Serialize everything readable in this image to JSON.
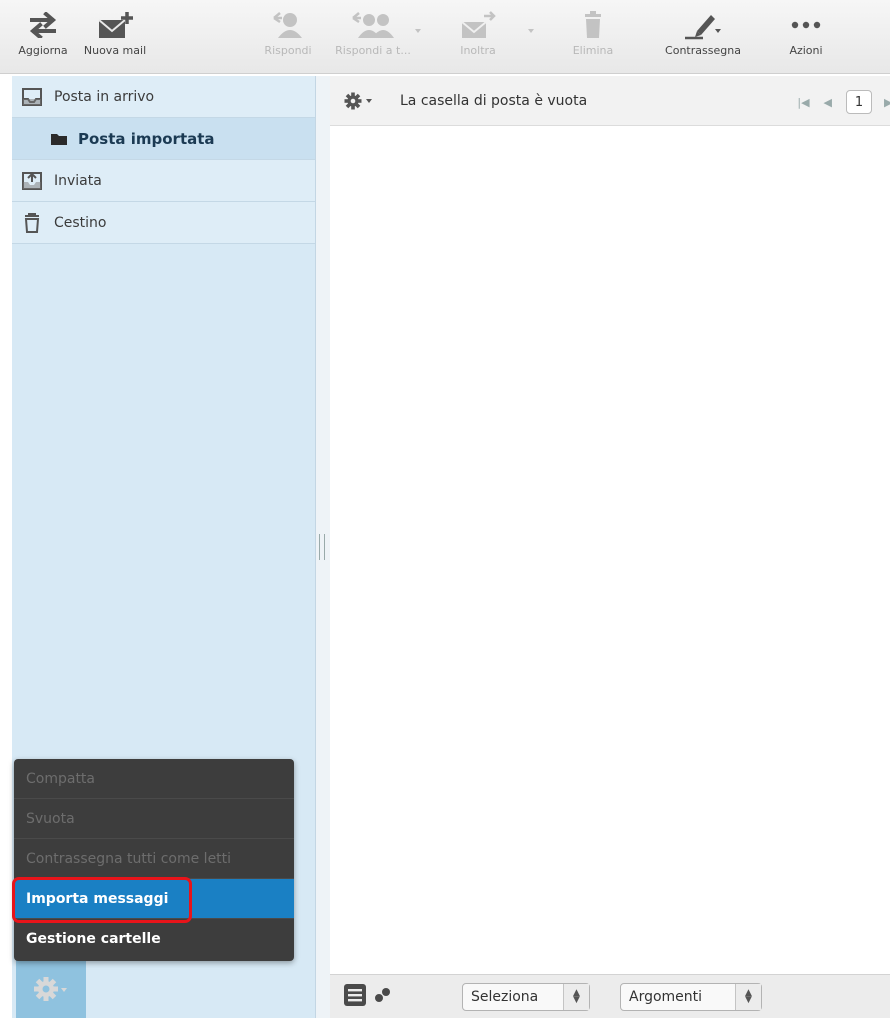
{
  "toolbar": {
    "refresh_label": "Aggiorna",
    "new_mail_label": "Nuova mail",
    "reply_label": "Rispondi",
    "reply_all_label": "Rispondi a t...",
    "forward_label": "Inoltra",
    "delete_label": "Elimina",
    "mark_label": "Contrassegna",
    "actions_label": "Azioni"
  },
  "sidebar": {
    "folders": [
      {
        "label": "Posta in arrivo",
        "icon": "inbox-icon"
      },
      {
        "label": "Posta importata",
        "icon": "folder-icon"
      },
      {
        "label": "Inviata",
        "icon": "sent-icon"
      },
      {
        "label": "Cestino",
        "icon": "trash-icon"
      }
    ]
  },
  "menu": {
    "items": [
      {
        "label": "Compatta",
        "enabled": false
      },
      {
        "label": "Svuota",
        "enabled": false
      },
      {
        "label": "Contrassegna tutti come letti",
        "enabled": false
      },
      {
        "label": "Importa messaggi",
        "enabled": true,
        "selected": true
      },
      {
        "label": "Gestione cartelle",
        "enabled": true
      }
    ]
  },
  "main": {
    "status": "La casella di posta è vuota",
    "page": "1"
  },
  "footer": {
    "select_label": "Seleziona",
    "threads_label": "Argomenti"
  },
  "colors": {
    "sidebar_bg": "#d7e9f5",
    "menu_bg": "#3d3d3d",
    "menu_selected": "#1a80c4",
    "highlight": "#e8141a",
    "gear_bg": "#8fc2df"
  }
}
